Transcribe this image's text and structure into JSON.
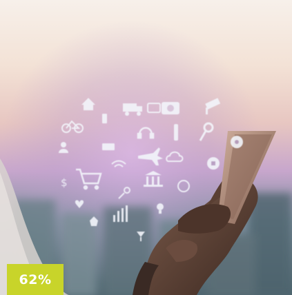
{
  "photo": {
    "subject": "hand-holding-smartphone-with-floating-icons",
    "icons": [
      "house-icon",
      "truck-icon",
      "tv-icon",
      "camera-icon",
      "cctv-icon",
      "bicycle-icon",
      "phone-icon",
      "headphones-icon",
      "bottle-icon",
      "pin-icon",
      "user-icon",
      "printer-icon",
      "gear-icon",
      "wifi-icon",
      "airplane-icon",
      "cloud-icon",
      "lock-icon",
      "dollar-icon",
      "cart-icon",
      "key-icon",
      "bank-icon",
      "globe-icon",
      "heart-icon",
      "home-icon",
      "bar-chart-icon",
      "bulb-icon",
      "cocktail-icon"
    ]
  },
  "badge": {
    "value": "62%",
    "background": "#c8d42a",
    "text_color": "#ffffff"
  },
  "colors": {
    "sky_top": "#f6ede6",
    "haze": "#e7c9c2",
    "purple": "#b58fc8",
    "city": "#5f7a86",
    "skin": "#5b4034"
  }
}
